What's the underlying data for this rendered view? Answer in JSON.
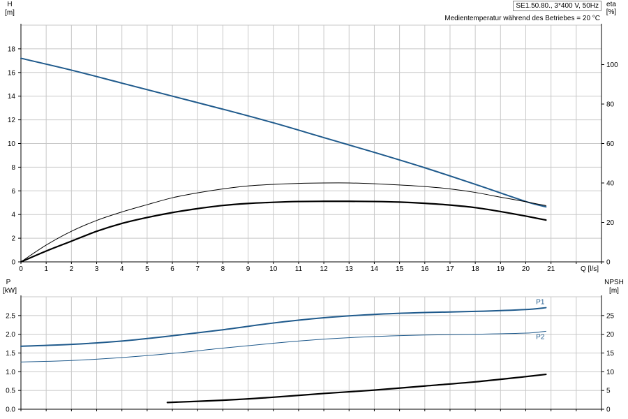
{
  "header": {
    "model": "SE1.50.80., 3*400 V, 50Hz",
    "temperature_note": "Medientemperatur während des Betriebes = 20 °C"
  },
  "chart_data": [
    {
      "type": "line",
      "xlabel": "Q [l/s]",
      "ylabel": "H [m]",
      "ylabel_right": "eta [%]",
      "xlim": [
        0,
        23
      ],
      "ylim": [
        0,
        20
      ],
      "ylim_right": [
        0,
        120
      ],
      "x_ticks": [
        0,
        1,
        2,
        3,
        4,
        5,
        6,
        7,
        8,
        9,
        10,
        11,
        12,
        13,
        14,
        15,
        16,
        17,
        18,
        19,
        20,
        21
      ],
      "y_ticks": [
        0,
        2,
        4,
        6,
        8,
        10,
        12,
        14,
        16,
        18
      ],
      "y_right_ticks": [
        0,
        20,
        40,
        60,
        80,
        100
      ],
      "grid": true,
      "series": [
        {
          "axis": "left",
          "color": "#1f5a8c",
          "width": 2,
          "x": [
            0,
            2,
            4,
            6,
            8,
            10,
            12,
            14,
            16,
            18,
            20,
            20.8
          ],
          "y": [
            17.2,
            16.2,
            15.1,
            14.0,
            12.9,
            11.75,
            10.5,
            9.25,
            7.95,
            6.55,
            5.1,
            4.65
          ]
        },
        {
          "axis": "right",
          "color": "#000000",
          "width": 1,
          "x": [
            0,
            1,
            2,
            3,
            4,
            5,
            6,
            7,
            8,
            9,
            10,
            11,
            12,
            13,
            14,
            15,
            16,
            17,
            18,
            19,
            20,
            20.8
          ],
          "y": [
            0,
            8.5,
            15.5,
            21,
            25.3,
            29,
            32.5,
            35,
            37,
            38.5,
            39.3,
            39.8,
            40,
            40,
            39.6,
            39,
            38.2,
            37,
            35.2,
            32.8,
            30.5,
            28.5
          ]
        },
        {
          "axis": "right",
          "color": "#000000",
          "width": 2.2,
          "x": [
            0,
            1,
            2,
            3,
            4,
            5,
            6,
            7,
            8,
            9,
            10,
            11,
            12,
            13,
            14,
            15,
            16,
            17,
            18,
            19,
            20,
            20.8
          ],
          "y": [
            0,
            5.5,
            10.5,
            15.5,
            19.5,
            22.5,
            25,
            27,
            28.6,
            29.6,
            30.2,
            30.6,
            30.7,
            30.7,
            30.6,
            30.3,
            29.7,
            28.8,
            27.5,
            25.5,
            23.2,
            21.2
          ]
        }
      ]
    },
    {
      "type": "line",
      "ylabel": "P [kW]",
      "ylabel_right": "NPSH [m]",
      "xlim": [
        0,
        23
      ],
      "ylim": [
        0,
        3
      ],
      "ylim_right": [
        0,
        30
      ],
      "y_ticks": [
        0,
        0.5,
        1.0,
        1.5,
        2.0,
        2.5
      ],
      "y_tick_labels": [
        "0.0",
        "0.5",
        "1.0",
        "1.5",
        "2.0",
        "2.5"
      ],
      "y_right_ticks": [
        0,
        5,
        10,
        15,
        20,
        25
      ],
      "grid": true,
      "series": [
        {
          "name": "P1",
          "axis": "left",
          "color": "#1f5a8c",
          "width": 2,
          "x": [
            0,
            2,
            4,
            6,
            8,
            10,
            12,
            14,
            16,
            18,
            20,
            20.8
          ],
          "y": [
            1.68,
            1.73,
            1.82,
            1.96,
            2.12,
            2.3,
            2.44,
            2.53,
            2.58,
            2.61,
            2.66,
            2.71
          ]
        },
        {
          "name": "P2",
          "axis": "left",
          "color": "#1f5a8c",
          "width": 1,
          "x": [
            0,
            2,
            4,
            6,
            8,
            10,
            12,
            14,
            16,
            18,
            20,
            20.8
          ],
          "y": [
            1.26,
            1.3,
            1.38,
            1.49,
            1.63,
            1.76,
            1.87,
            1.94,
            1.98,
            2.0,
            2.03,
            2.08
          ]
        },
        {
          "axis": "right",
          "color": "#000000",
          "width": 2.2,
          "x": [
            5.8,
            8,
            10,
            12,
            14,
            16,
            18,
            20,
            20.8
          ],
          "y": [
            1.8,
            2.4,
            3.2,
            4.2,
            5.1,
            6.2,
            7.3,
            8.7,
            9.3
          ]
        }
      ]
    }
  ]
}
